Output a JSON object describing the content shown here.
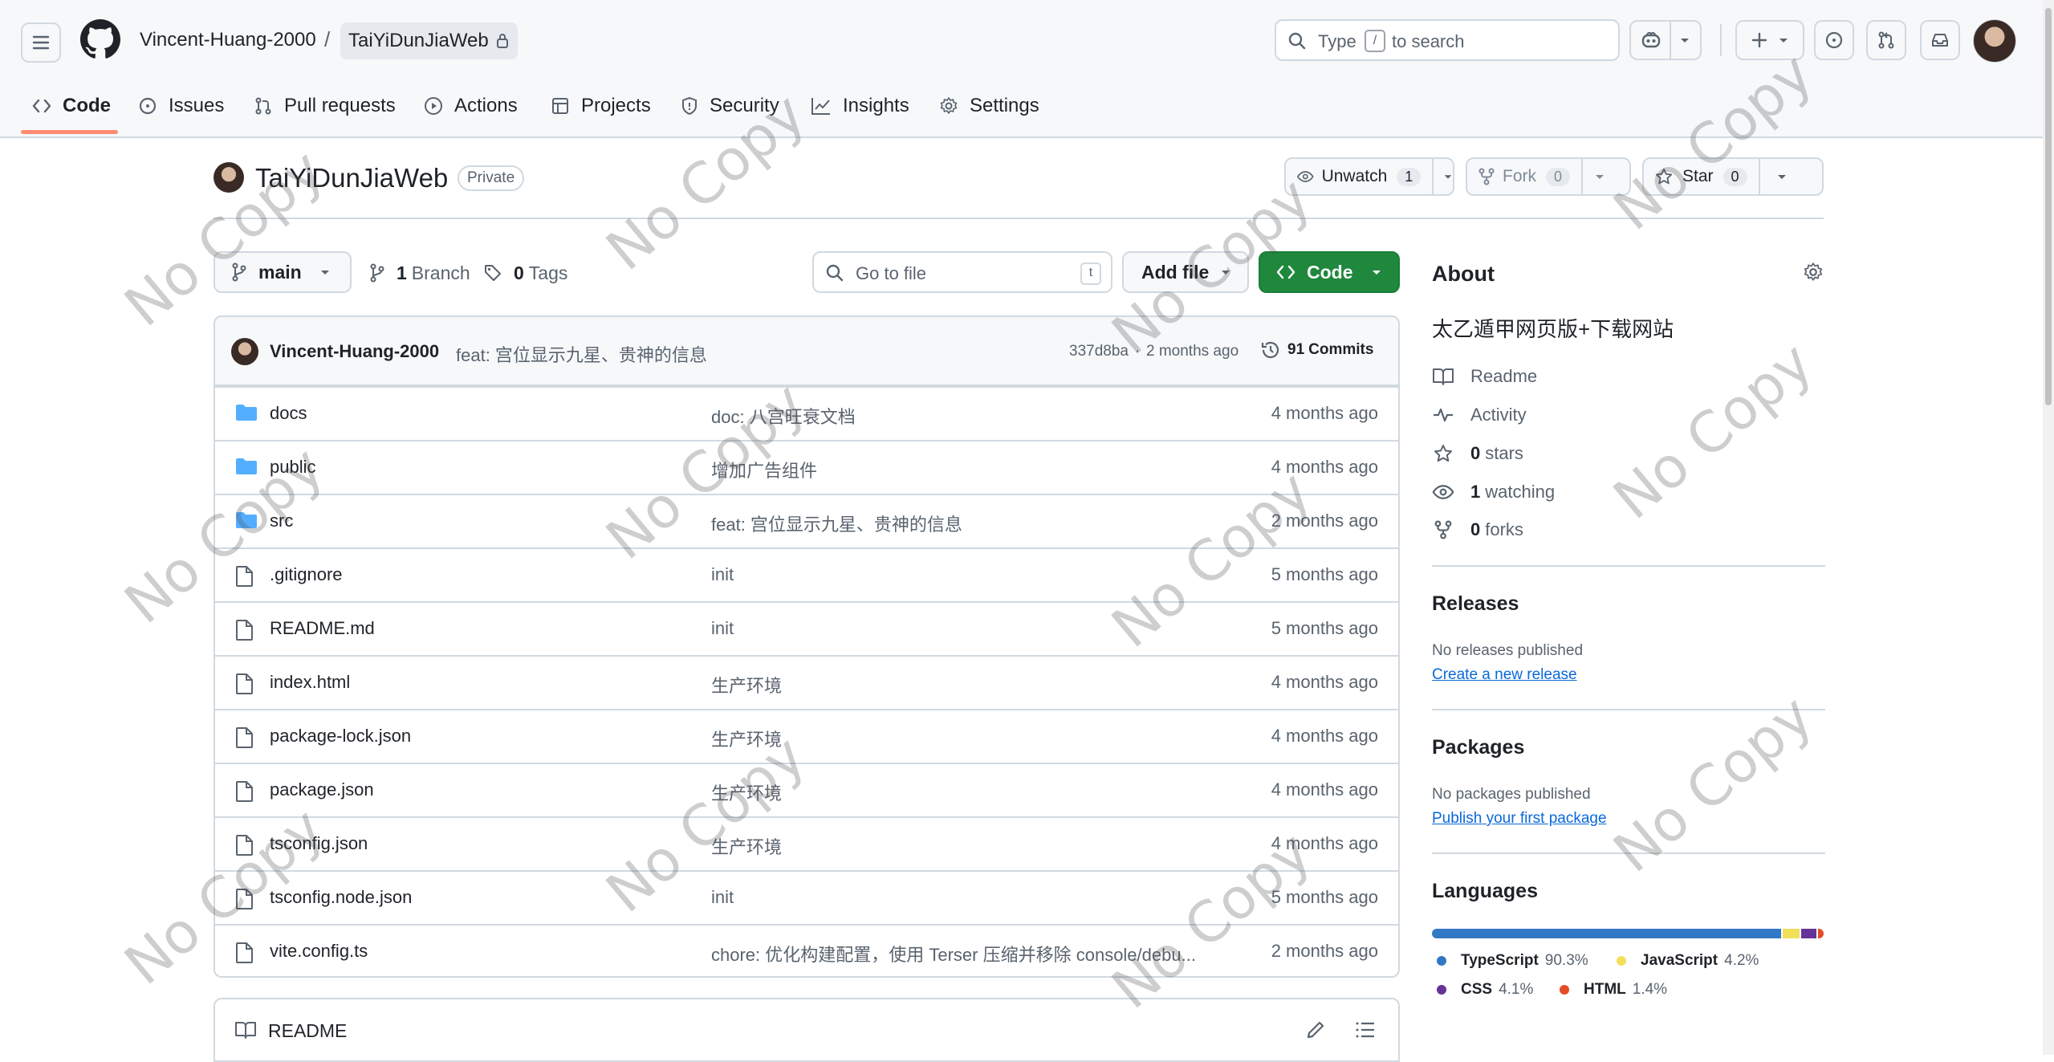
{
  "header": {
    "owner": "Vincent-Huang-2000",
    "separator": "/",
    "repo": "TaiYiDunJiaWeb",
    "search_prefix": "Type",
    "search_key": "/",
    "search_suffix": "to search"
  },
  "tabs": [
    {
      "label": "Code",
      "icon": "code-icon"
    },
    {
      "label": "Issues",
      "icon": "issue-icon"
    },
    {
      "label": "Pull requests",
      "icon": "pull-request-icon"
    },
    {
      "label": "Actions",
      "icon": "play-icon"
    },
    {
      "label": "Projects",
      "icon": "table-icon"
    },
    {
      "label": "Security",
      "icon": "shield-icon"
    },
    {
      "label": "Insights",
      "icon": "graph-icon"
    },
    {
      "label": "Settings",
      "icon": "gear-icon"
    }
  ],
  "repo_head": {
    "name": "TaiYiDunJiaWeb",
    "visibility": "Private",
    "unwatch_label": "Unwatch",
    "watch_count": "1",
    "fork_label": "Fork",
    "fork_count": "0",
    "star_label": "Star",
    "star_count": "0"
  },
  "toolbar": {
    "branch": "main",
    "branch_count": "1",
    "branch_label": "Branch",
    "tag_count": "0",
    "tag_label": "Tags",
    "go_to_file_placeholder": "Go to file",
    "go_to_file_key": "t",
    "add_file_label": "Add file",
    "code_label": "Code"
  },
  "latest_commit": {
    "author": "Vincent-Huang-2000",
    "message": "feat: 宫位显示九星、贵神的信息",
    "sha": "337d8ba",
    "dot": "·",
    "time": "2 months ago",
    "commit_count": "91",
    "commit_label": "Commits"
  },
  "files": [
    {
      "name": "docs",
      "type": "folder",
      "message": "doc: 八宫旺衰文档",
      "date": "4 months ago"
    },
    {
      "name": "public",
      "type": "folder",
      "message": "增加广告组件",
      "date": "4 months ago"
    },
    {
      "name": "src",
      "type": "folder",
      "message": "feat: 宫位显示九星、贵神的信息",
      "date": "2 months ago"
    },
    {
      "name": ".gitignore",
      "type": "file",
      "message": "init",
      "date": "5 months ago"
    },
    {
      "name": "README.md",
      "type": "file",
      "message": "init",
      "date": "5 months ago"
    },
    {
      "name": "index.html",
      "type": "file",
      "message": "生产环境",
      "date": "4 months ago"
    },
    {
      "name": "package-lock.json",
      "type": "file",
      "message": "生产环境",
      "date": "4 months ago"
    },
    {
      "name": "package.json",
      "type": "file",
      "message": "生产环境",
      "date": "4 months ago"
    },
    {
      "name": "tsconfig.json",
      "type": "file",
      "message": "生产环境",
      "date": "4 months ago"
    },
    {
      "name": "tsconfig.node.json",
      "type": "file",
      "message": "init",
      "date": "5 months ago"
    },
    {
      "name": "vite.config.ts",
      "type": "file",
      "message": "chore: 优化构建配置，使用 Terser 压缩并移除 console/debu...",
      "date": "2 months ago"
    }
  ],
  "readme": {
    "label": "README"
  },
  "about": {
    "title": "About",
    "description": "太乙遁甲网页版+下载网站",
    "readme": "Readme",
    "activity": "Activity",
    "stars_count": "0",
    "stars_label": "stars",
    "watching_count": "1",
    "watching_label": "watching",
    "forks_count": "0",
    "forks_label": "forks"
  },
  "releases": {
    "title": "Releases",
    "empty": "No releases published",
    "link": "Create a new release"
  },
  "packages": {
    "title": "Packages",
    "empty": "No packages published",
    "link": "Publish your first package"
  },
  "languages": {
    "title": "Languages",
    "items": [
      {
        "name": "TypeScript",
        "percent": "90.3%",
        "value": 90.3,
        "color": "#3178c6"
      },
      {
        "name": "JavaScript",
        "percent": "4.2%",
        "value": 4.2,
        "color": "#f1e05a"
      },
      {
        "name": "CSS",
        "percent": "4.1%",
        "value": 4.1,
        "color": "#663399"
      },
      {
        "name": "HTML",
        "percent": "1.4%",
        "value": 1.4,
        "color": "#e34c26"
      }
    ]
  },
  "watermark": "No Copy",
  "colors": {
    "accent_underline": "#fd8c73",
    "green_button": "#1f883d",
    "folder": "#54aeff",
    "link": "#0969da"
  }
}
